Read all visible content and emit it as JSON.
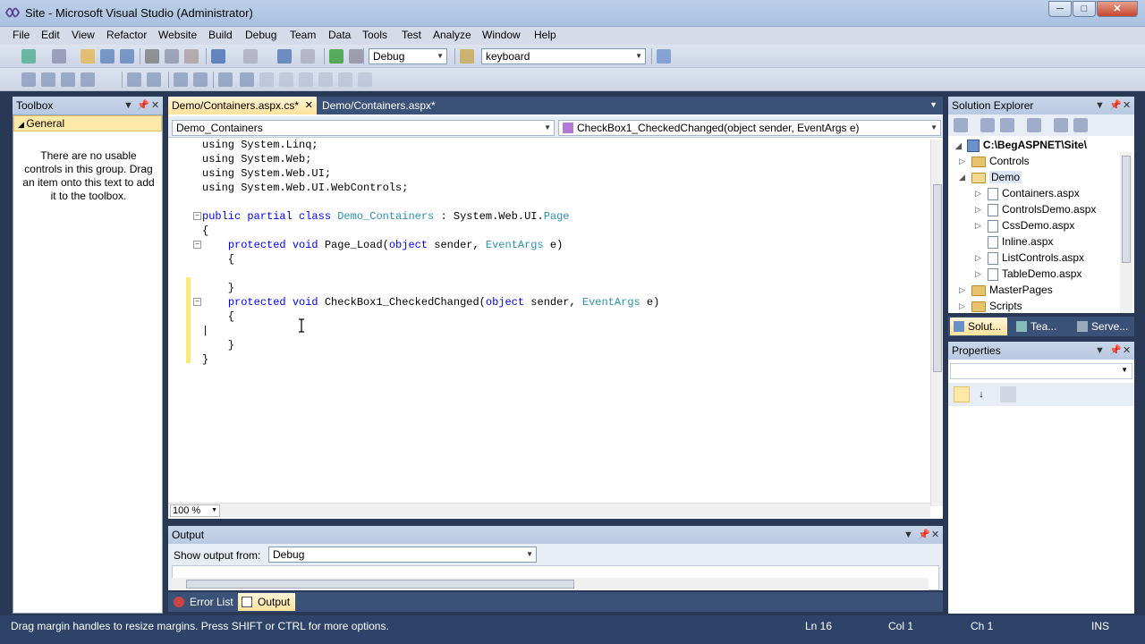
{
  "window": {
    "title": "Site - Microsoft Visual Studio (Administrator)",
    "min": "─",
    "max": "□",
    "close": "✕"
  },
  "menu": [
    "File",
    "Edit",
    "View",
    "Refactor",
    "Website",
    "Build",
    "Debug",
    "Team",
    "Data",
    "Tools",
    "Test",
    "Analyze",
    "Window",
    "Help"
  ],
  "toolbar": {
    "config": "Debug",
    "find": "keyboard"
  },
  "toolbox": {
    "title": "Toolbox",
    "group": "General",
    "empty_text": "There are no usable controls in this group. Drag an item onto this text to add it to the toolbox."
  },
  "editor": {
    "tabs": [
      {
        "label": "Demo/Containers.aspx.cs*",
        "active": true
      },
      {
        "label": "Demo/Containers.aspx*",
        "active": false
      }
    ],
    "class_dropdown": "Demo_Containers",
    "member_dropdown": "CheckBox1_CheckedChanged(object sender, EventArgs e)",
    "zoom": "100 %",
    "lines": [
      [
        [
          "",
          "using System.Linq;"
        ]
      ],
      [
        [
          "",
          "using System.Web;"
        ]
      ],
      [
        [
          "",
          "using System.Web.UI;"
        ]
      ],
      [
        [
          "",
          "using System.Web.UI.WebControls;"
        ]
      ],
      [],
      [
        [
          "kw",
          "public partial class "
        ],
        [
          "ty",
          "Demo_Containers"
        ],
        [
          "",
          " : System.Web.UI."
        ],
        [
          "ty",
          "Page"
        ]
      ],
      [
        [
          "",
          "{"
        ]
      ],
      [
        [
          "",
          "    "
        ],
        [
          "kw",
          "protected void "
        ],
        [
          "",
          "Page_Load("
        ],
        [
          "kw",
          "object"
        ],
        [
          "",
          " sender, "
        ],
        [
          "ty",
          "EventArgs"
        ],
        [
          "",
          " e)"
        ]
      ],
      [
        [
          "",
          "    {"
        ]
      ],
      [],
      [
        [
          "",
          "    }"
        ]
      ],
      [
        [
          "",
          "    "
        ],
        [
          "kw",
          "protected void "
        ],
        [
          "",
          "CheckBox1_CheckedChanged("
        ],
        [
          "kw",
          "object"
        ],
        [
          "",
          " sender, "
        ],
        [
          "ty",
          "EventArgs"
        ],
        [
          "",
          " e)"
        ]
      ],
      [
        [
          "",
          "    {"
        ]
      ],
      [
        [
          "",
          "|"
        ]
      ],
      [
        [
          "",
          "    }"
        ]
      ],
      [
        [
          "",
          "}"
        ]
      ]
    ]
  },
  "output": {
    "title": "Output",
    "show_label": "Show output from:",
    "source": "Debug"
  },
  "bottom_tabs": [
    {
      "label": "Error List"
    },
    {
      "label": "Output"
    }
  ],
  "solution": {
    "title": "Solution Explorer",
    "root": "C:\\BegASPNET\\Site\\",
    "items": [
      {
        "label": "Controls",
        "type": "folder",
        "level": 1,
        "exp": "▷"
      },
      {
        "label": "Demo",
        "type": "folder",
        "level": 1,
        "exp": "◢"
      },
      {
        "label": "Containers.aspx",
        "type": "file",
        "level": 2,
        "exp": "▷"
      },
      {
        "label": "ControlsDemo.aspx",
        "type": "file",
        "level": 2,
        "exp": "▷"
      },
      {
        "label": "CssDemo.aspx",
        "type": "file",
        "level": 2,
        "exp": "▷"
      },
      {
        "label": "Inline.aspx",
        "type": "file",
        "level": 2,
        "exp": ""
      },
      {
        "label": "ListControls.aspx",
        "type": "file",
        "level": 2,
        "exp": "▷"
      },
      {
        "label": "TableDemo.aspx",
        "type": "file",
        "level": 2,
        "exp": "▷"
      },
      {
        "label": "MasterPages",
        "type": "folder",
        "level": 1,
        "exp": "▷"
      },
      {
        "label": "Scripts",
        "type": "folder",
        "level": 1,
        "exp": "▷"
      }
    ],
    "tabs": [
      "Solut...",
      "Tea...",
      "Serve..."
    ]
  },
  "properties": {
    "title": "Properties"
  },
  "status": {
    "message": "Drag margin handles to resize margins. Press SHIFT or CTRL for more options.",
    "ln": "Ln 16",
    "col": "Col 1",
    "ch": "Ch 1",
    "ins": "INS"
  }
}
